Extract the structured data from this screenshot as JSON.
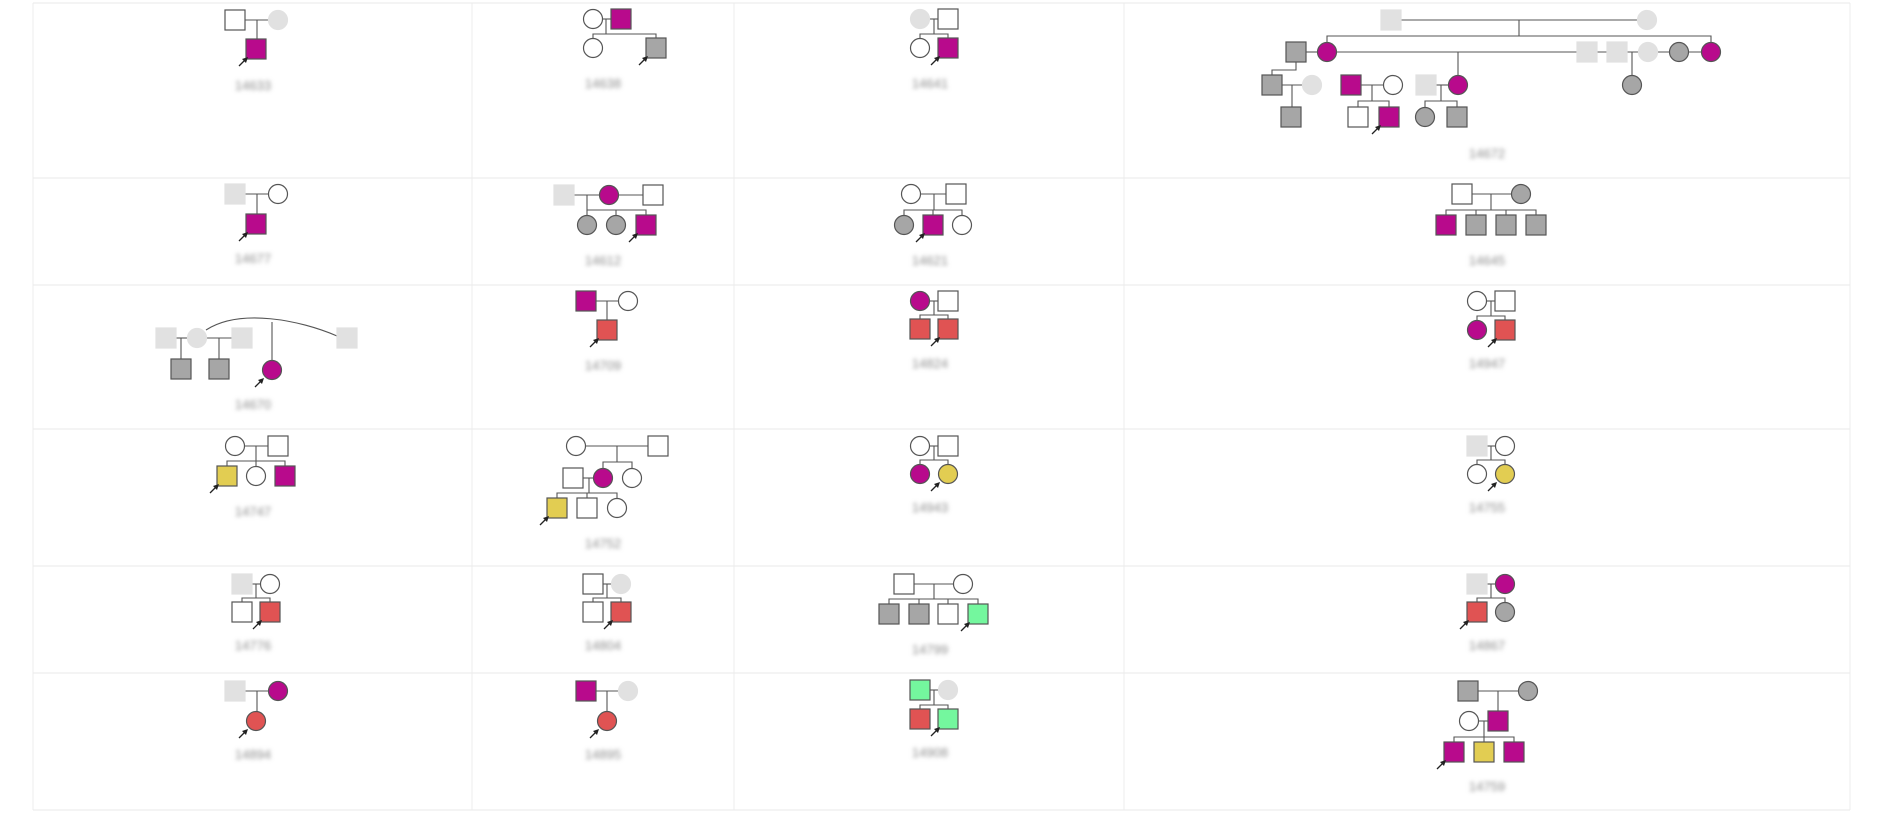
{
  "colors": {
    "unaffected": "#ffffff",
    "unknown": "#e1e1e1",
    "affected_gray": "#a6a6a6",
    "affected_magenta": "#b80a8c",
    "affected_red": "#e05353",
    "affected_yellow": "#e2cd52",
    "affected_green": "#74f79e",
    "outline": "#555555",
    "grid": "#e9e9e9"
  },
  "families": [
    {
      "id": "c1",
      "label": "14633"
    },
    {
      "id": "c2",
      "label": "14638"
    },
    {
      "id": "c3",
      "label": "14641"
    },
    {
      "id": "c4",
      "label": "14672"
    },
    {
      "id": "c5",
      "label": "14677"
    },
    {
      "id": "c6",
      "label": "14612"
    },
    {
      "id": "c7",
      "label": "14621"
    },
    {
      "id": "c8",
      "label": "14645"
    },
    {
      "id": "c9",
      "label": "14670"
    },
    {
      "id": "c10",
      "label": "14709"
    },
    {
      "id": "c11",
      "label": "14824"
    },
    {
      "id": "c12",
      "label": "14947"
    },
    {
      "id": "c13",
      "label": "14747"
    },
    {
      "id": "c14",
      "label": "14752"
    },
    {
      "id": "c15",
      "label": "14943"
    },
    {
      "id": "c16",
      "label": "14755"
    },
    {
      "id": "c17",
      "label": "14776"
    },
    {
      "id": "c18",
      "label": "14804"
    },
    {
      "id": "c19",
      "label": "14799"
    },
    {
      "id": "c20",
      "label": "14867"
    },
    {
      "id": "c21",
      "label": "14894"
    },
    {
      "id": "c22",
      "label": "14895"
    },
    {
      "id": "c23",
      "label": "14908"
    },
    {
      "id": "c24",
      "label": "14759"
    }
  ]
}
